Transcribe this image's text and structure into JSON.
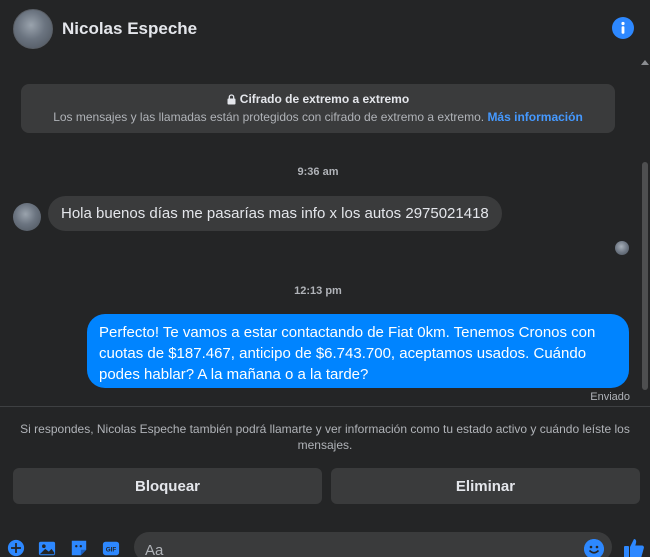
{
  "header": {
    "name": "Nicolas Espeche",
    "info_icon": "info-icon"
  },
  "encryption": {
    "title": "Cifrado de extremo a extremo",
    "text": "Los mensajes y las llamadas están protegidos con cifrado de extremo a extremo.",
    "link": "Más información",
    "icon": "lock-icon"
  },
  "messages": [
    {
      "timestamp": "9:36 am",
      "direction": "incoming",
      "text": "Hola buenos días me pasarías mas info x los autos 2975021418"
    },
    {
      "timestamp": "12:13 pm",
      "direction": "outgoing",
      "text": "Perfecto! Te vamos a estar contactando de Fiat 0km. Tenemos Cronos con cuotas de $187.467, anticipo de $6.743.700, aceptamos usados. Cuándo podes hablar? A la mañana o a la tarde?",
      "status": "Enviado"
    }
  ],
  "notice": "Si respondes, Nicolas Espeche también podrá llamarte y ver información como tu estado activo y cuándo leíste los mensajes.",
  "actions": {
    "block": "Bloquear",
    "delete": "Eliminar"
  },
  "composer": {
    "placeholder": "Aa",
    "tools": [
      "plus-icon",
      "image-icon",
      "sticker-icon",
      "gif-icon"
    ],
    "emoji_icon": "emoji-icon",
    "like_icon": "thumbs-up-icon"
  },
  "colors": {
    "background": "#242526",
    "accent": "#0084ff",
    "bubble_in": "#3a3b3c",
    "link": "#4599ff"
  }
}
